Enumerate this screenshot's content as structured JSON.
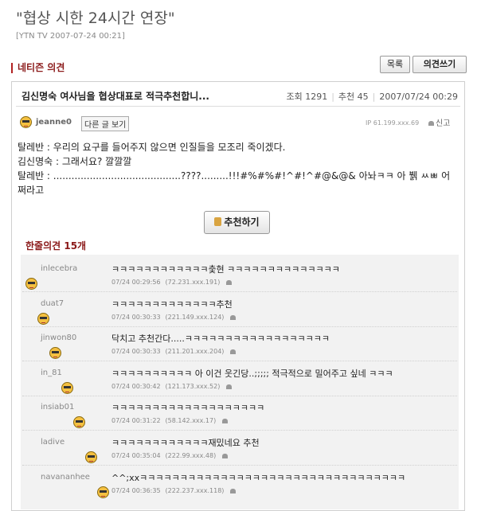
{
  "article": {
    "title": "\"협상 시한 24시간 연장\"",
    "meta": "[YTN TV 2007-07-24 00:21]"
  },
  "section": {
    "label": "네티즌 의견"
  },
  "buttons": {
    "list": "목록",
    "write": "의견쓰기"
  },
  "post": {
    "title": "김신명숙 여사님을 협상대표로 적극추천합니...",
    "views_label": "조회",
    "views": "1291",
    "recommend_label": "추천",
    "recommends": "45",
    "date": "2007/07/24 00:29",
    "author": "jeanne0",
    "other_posts": "다른 글 보기",
    "ip": "IP 61.199.xxx.69",
    "report": "신고",
    "body": [
      "탈레반 : 우리의 요구를 들어주지 않으면 인질들을 모조리 죽이겠다.",
      "김신명숙 : 그래서요? 깔깔깔",
      "탈레반 : ..........................................????.........!!!#%#%#!^#!^#@&@& 아놔ㅋㅋ 아 뷁 ㅆㅃ 어쩌라고"
    ],
    "recommend_button": "추천하기"
  },
  "comments": {
    "header": "한줄의견 15개",
    "items": [
      {
        "user": "inlecebra",
        "text": "ㅋㅋㅋㅋㅋㅋㅋㅋㅋㅋㅋㅋ춫현 ㅋㅋㅋㅋㅋㅋㅋㅋㅋㅋㅋㅋㅋㅋ",
        "time": "07/24 00:29:56",
        "ip": "(72.231.xxx.191)"
      },
      {
        "user": "duat7",
        "text": "ㅋㅋㅋㅋㅋㅋㅋㅋㅋㅋㅋㅋㅋ추천",
        "time": "07/24 00:30:33",
        "ip": "(221.149.xxx.124)"
      },
      {
        "user": "jinwon80",
        "text": "닥치고 추천간다.....ㅋㅋㅋㅋㅋㅋㅋㅋㅋㅋㅋㅋㅋㅋㅋㅋㅋㅋ",
        "time": "07/24 00:30:33",
        "ip": "(211.201.xxx.204)"
      },
      {
        "user": "in_81",
        "text": "ㅋㅋㅋㅋㅋㅋㅋㅋㅋㅋ 아 이건 웃긴당..;;;;; 적극적으로 밀어주고 싶네 ㅋㅋㅋ",
        "time": "07/24 00:30:42",
        "ip": "(121.173.xxx.52)"
      },
      {
        "user": "insiab01",
        "text": "ㅋㅋㅋㅋㅋㅋㅋㅋㅋㅋㅋㅋㅋㅋㅋㅋㅋㅋㅋ",
        "time": "07/24 00:31:22",
        "ip": "(58.142.xxx.17)"
      },
      {
        "user": "ladive",
        "text": "ㅋㅋㅋㅋㅋㅋㅋㅋㅋㅋㅋㅋ재밌네요 추천",
        "time": "07/24 00:35:04",
        "ip": "(222.99.xxx.48)"
      },
      {
        "user": "navananhee",
        "text": "^^;xxㅋㅋㅋㅋㅋㅋㅋㅋㅋㅋㅋㅋㅋㅋㅋㅋㅋㅋㅋㅋㅋㅋㅋㅋㅋㅋㅋㅋㅋㅋㅋㅋㅋ",
        "time": "07/24 00:36:35",
        "ip": "(222.237.xxx.118)"
      }
    ]
  }
}
